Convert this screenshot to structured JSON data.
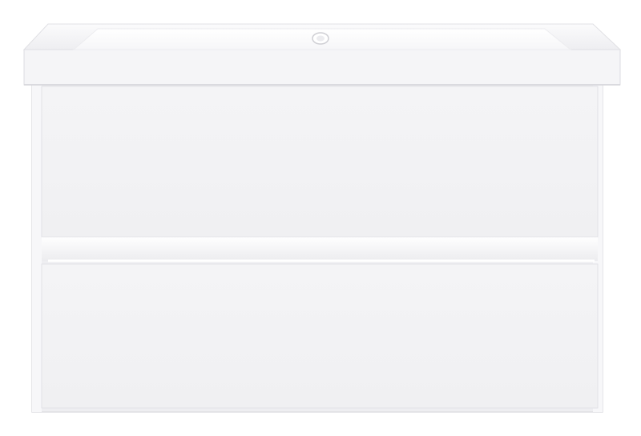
{
  "image": {
    "subject": "",
    "colors": {
      "background": "#ffffff",
      "cabinet": "#f1f1f3",
      "cabinet_shadow": "#e6e6ea",
      "basin_top": "#f7f7f9",
      "basin_inner": "#ffffff",
      "edge": "#dcdce0",
      "drain": "#e9e9ec"
    },
    "components": {
      "basin": "sink-basin",
      "drain": "drain-hole",
      "upper_drawer": "upper-drawer-front",
      "lower_drawer": "lower-drawer-front"
    }
  }
}
